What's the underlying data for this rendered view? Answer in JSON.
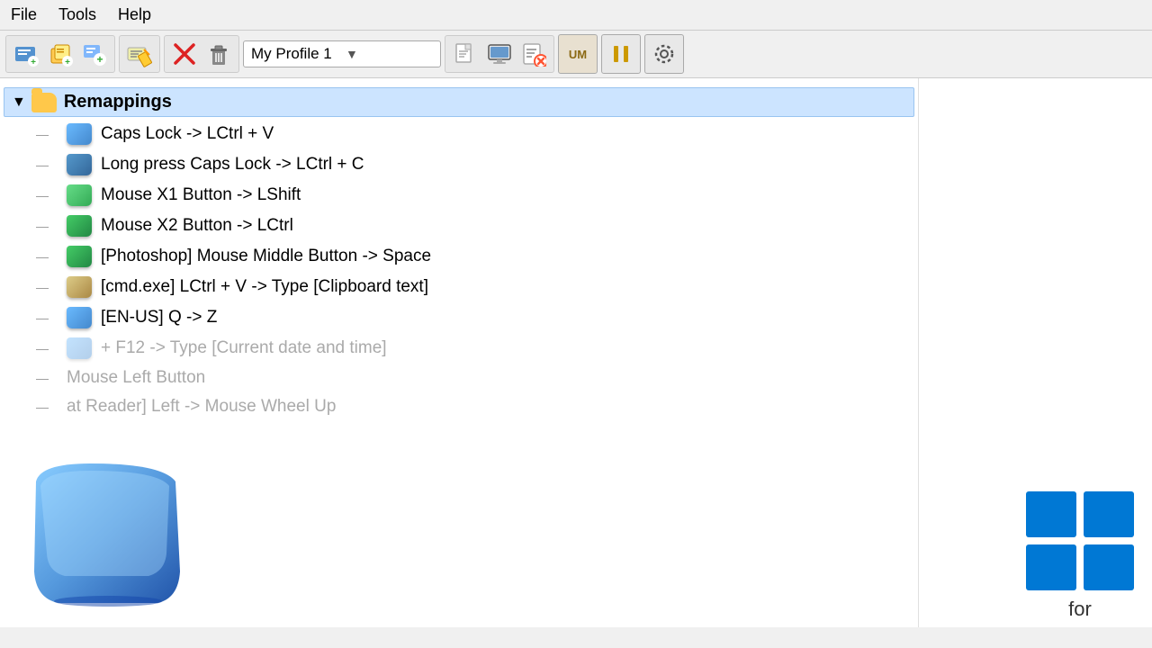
{
  "menu": {
    "file": "File",
    "tools": "Tools",
    "help": "Help"
  },
  "toolbar": {
    "profile_name": "My Profile 1",
    "dropdown_arrow": "▼"
  },
  "tree": {
    "root_label": "Remappings",
    "items": [
      {
        "id": 1,
        "icon": "blue-light",
        "text": "Caps Lock -> LCtrl + V"
      },
      {
        "id": 2,
        "icon": "blue-dark",
        "text": "Long press Caps Lock -> LCtrl + C"
      },
      {
        "id": 3,
        "icon": "green-light",
        "text": "Mouse X1 Button -> LShift"
      },
      {
        "id": 4,
        "icon": "green-dark",
        "text": "Mouse X2 Button -> LCtrl"
      },
      {
        "id": 5,
        "icon": "green-dark",
        "text": "[Photoshop] Mouse Middle Button -> Space"
      },
      {
        "id": 6,
        "icon": "yellow",
        "text": "[cmd.exe] LCtrl + V -> Type [Clipboard text]"
      },
      {
        "id": 7,
        "icon": "blue-light",
        "text": "[EN-US] Q -> Z"
      },
      {
        "id": 8,
        "icon": "blue-light",
        "text": "+ F12 -> Type [Current date and time]",
        "faded": true
      },
      {
        "id": 9,
        "icon": "none",
        "text": "Mouse Left Button",
        "faded": true
      },
      {
        "id": 10,
        "icon": "none",
        "text": "at Reader] Left -> Mouse Wheel Up",
        "faded": true
      }
    ]
  },
  "windows_label": "for"
}
